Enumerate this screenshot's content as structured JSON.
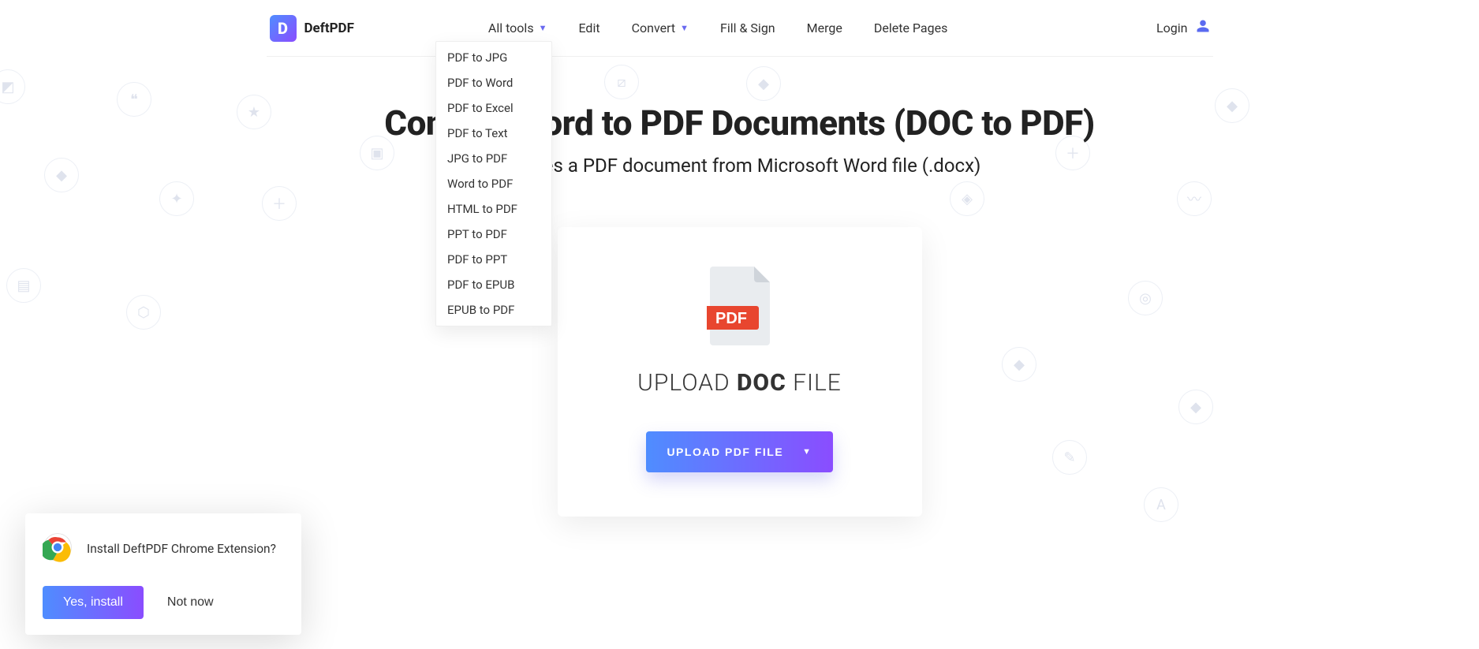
{
  "brand": {
    "initial": "D",
    "name": "DeftPDF"
  },
  "nav": {
    "allTools": "All tools",
    "edit": "Edit",
    "convert": "Convert",
    "fillSign": "Fill & Sign",
    "merge": "Merge",
    "deletePages": "Delete Pages"
  },
  "convertMenu": [
    "PDF to JPG",
    "PDF to Word",
    "PDF to Excel",
    "PDF to Text",
    "JPG to PDF",
    "Word to PDF",
    "HTML to PDF",
    "PPT to PDF",
    "PDF to PPT",
    "PDF to EPUB",
    "EPUB to PDF"
  ],
  "auth": {
    "login": "Login"
  },
  "hero": {
    "title": "Convert Word to PDF Documents (DOC to PDF)",
    "subtitle": "Creates a PDF document from Microsoft Word file (.docx)"
  },
  "upload": {
    "badge": "PDF",
    "textPrefix": "UPLOAD ",
    "textBold": "DOC",
    "textSuffix": " FILE",
    "button": "UPLOAD PDF FILE"
  },
  "extension": {
    "message": "Install DeftPDF Chrome Extension?",
    "install": "Yes, install",
    "dismiss": "Not now"
  }
}
